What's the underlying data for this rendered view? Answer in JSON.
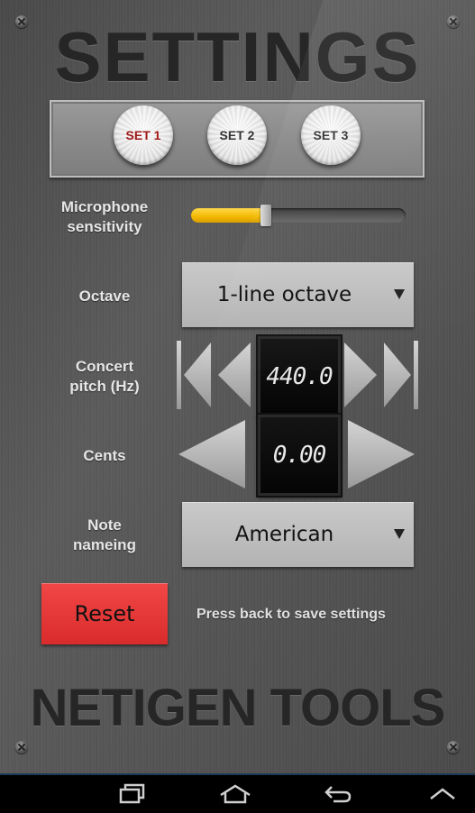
{
  "header": {
    "title": "SETTINGS"
  },
  "sets": [
    {
      "label": "SET 1",
      "active": true
    },
    {
      "label": "SET 2",
      "active": false
    },
    {
      "label": "SET 3",
      "active": false
    }
  ],
  "microphone": {
    "label_line1": "Microphone",
    "label_line2": "sensitivity",
    "level": 0.35,
    "fill_color": "#f2b800"
  },
  "octave": {
    "label": "Octave",
    "value": "1-line octave"
  },
  "concert_pitch": {
    "label_line1": "Concert",
    "label_line2": "pitch (Hz)",
    "value": "440.0"
  },
  "cents": {
    "label": "Cents",
    "value": "0.00"
  },
  "note_naming": {
    "label_line1": "Note",
    "label_line2": "nameing",
    "value": "American"
  },
  "reset": {
    "label": "Reset",
    "color": "#e53a3a"
  },
  "hint": "Press back to save settings",
  "footer": {
    "brand": "NETIGEN TOOLS"
  },
  "navbar": {
    "icons": [
      "recent-apps-icon",
      "home-icon",
      "back-icon",
      "menu-up-icon"
    ]
  }
}
